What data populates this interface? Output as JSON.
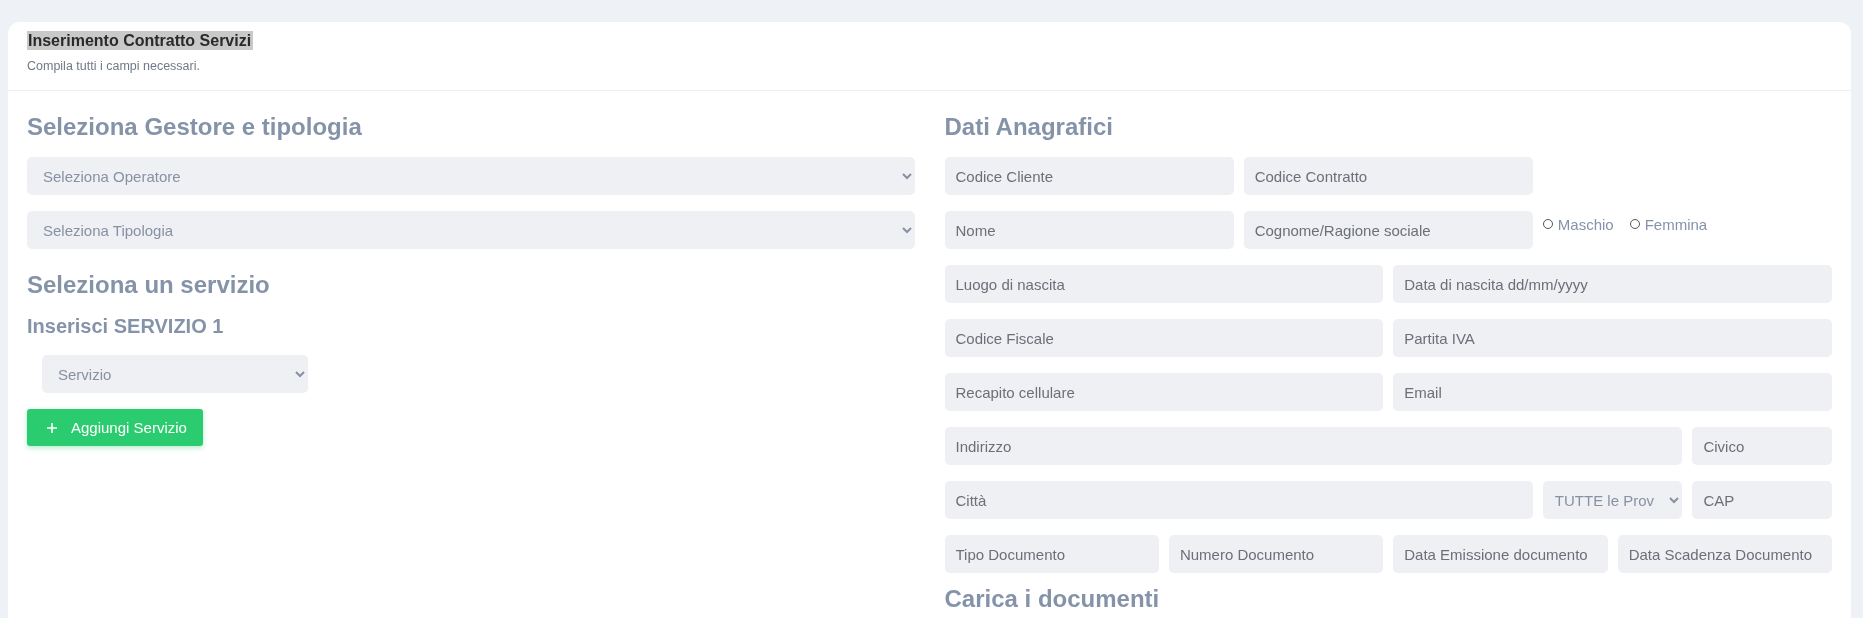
{
  "header": {
    "title": "Inserimento Contratto Servizi",
    "title_highlighted": true,
    "subtitle": "Compila tutti i campi necessari."
  },
  "left": {
    "heading": "Seleziona Gestore e tipologia",
    "selects": [
      {
        "value": "Seleziona Operatore"
      },
      {
        "value": "Seleziona Tipologia"
      }
    ],
    "service_heading": "Seleziona un servizio",
    "service_subheading": "Inserisci SERVIZIO 1",
    "service_select": {
      "value": "Servizio"
    },
    "add_button": "Aggiungi Servizio"
  },
  "right": {
    "heading": "Dati Anagrafici",
    "rows": [
      {
        "kind": "short",
        "items": [
          {
            "kind": "input",
            "placeholder": "Codice Cliente"
          },
          {
            "kind": "input",
            "placeholder": "Codice Contratto"
          }
        ]
      },
      {
        "kind": "short",
        "items": [
          {
            "kind": "input",
            "placeholder": "Nome"
          },
          {
            "kind": "input",
            "placeholder": "Cognome/Ragione sociale"
          },
          {
            "kind": "radios",
            "options": [
              {
                "label": "Maschio",
                "checked": false
              },
              {
                "label": "Femmina",
                "checked": false
              }
            ]
          }
        ]
      },
      {
        "kind": "half",
        "items": [
          {
            "kind": "input",
            "placeholder": "Luogo di nascita"
          },
          {
            "kind": "input",
            "placeholder": "Data di nascita dd/mm/yyyy"
          }
        ]
      },
      {
        "kind": "half",
        "items": [
          {
            "kind": "input",
            "placeholder": "Codice Fiscale"
          },
          {
            "kind": "input",
            "placeholder": "Partita IVA"
          }
        ]
      },
      {
        "kind": "half",
        "items": [
          {
            "kind": "input",
            "placeholder": "Recapito cellulare"
          },
          {
            "kind": "input",
            "placeholder": "Email"
          }
        ]
      },
      {
        "kind": "address",
        "items": [
          {
            "kind": "input",
            "placeholder": "Indirizzo"
          },
          {
            "kind": "input",
            "placeholder": "Civico"
          }
        ]
      },
      {
        "kind": "city",
        "items": [
          {
            "kind": "input",
            "placeholder": "Città"
          },
          {
            "kind": "select",
            "value": "TUTTE le Prov"
          },
          {
            "kind": "input",
            "placeholder": "CAP"
          }
        ]
      },
      {
        "kind": "quarter",
        "items": [
          {
            "kind": "input",
            "placeholder": "Tipo Documento"
          },
          {
            "kind": "input",
            "placeholder": "Numero Documento"
          },
          {
            "kind": "input",
            "placeholder": "Data Emissione documento"
          },
          {
            "kind": "input",
            "placeholder": "Data Scadenza Documento"
          }
        ]
      }
    ],
    "documents_heading": "Carica i documenti"
  }
}
